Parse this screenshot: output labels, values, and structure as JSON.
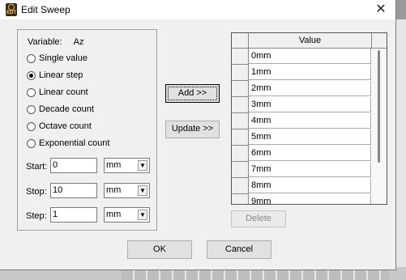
{
  "window": {
    "title": "Edit Sweep",
    "icon_text": "EDT",
    "close_glyph": "✕"
  },
  "variable": {
    "label": "Variable:",
    "value": "Az"
  },
  "radios": [
    {
      "label": "Single value",
      "checked": false
    },
    {
      "label": "Linear step",
      "checked": true
    },
    {
      "label": "Linear count",
      "checked": false
    },
    {
      "label": "Decade count",
      "checked": false
    },
    {
      "label": "Octave count",
      "checked": false
    },
    {
      "label": "Exponential count",
      "checked": false
    }
  ],
  "fields": {
    "start": {
      "label": "Start:",
      "value": "0",
      "unit": "mm"
    },
    "stop": {
      "label": "Stop:",
      "value": "10",
      "unit": "mm"
    },
    "step": {
      "label": "Step:",
      "value": "1",
      "unit": "mm"
    }
  },
  "buttons": {
    "add": "Add  >>",
    "update": "Update >>",
    "delete": "Delete",
    "ok": "OK",
    "cancel": "Cancel"
  },
  "table": {
    "header": "Value",
    "rows": [
      "0mm",
      "1mm",
      "2mm",
      "3mm",
      "4mm",
      "5mm",
      "6mm",
      "7mm",
      "8mm",
      "9mm"
    ]
  },
  "icons": {
    "dropdown": "chevron-down-icon",
    "close": "close-icon"
  }
}
